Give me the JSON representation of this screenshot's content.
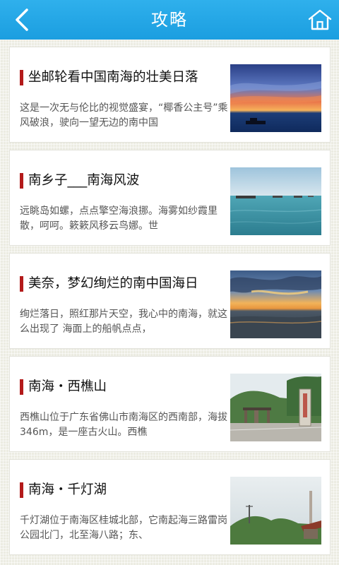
{
  "header": {
    "title": "攻略",
    "back_icon": "chevron-left-icon",
    "home_icon": "home-icon"
  },
  "colors": {
    "header": "#1ea2e3",
    "accent_bar": "#b31a1a"
  },
  "articles": [
    {
      "title": "坐邮轮看中国南海的壮美日落",
      "desc": "这是一次无与伦比的视觉盛宴，“椰香公主号”乘风破浪，驶向一望无边的南中国",
      "image": "sunset-cruise-image"
    },
    {
      "title": "南乡子___南海风波",
      "desc": "远眺岛如螺，点点擎空海浪挪。海雾如纱霞里散，呵呵。簌簌风移云鸟娜。世",
      "image": "sea-boats-image"
    },
    {
      "title": "美奈，梦幻绚烂的南中国海日",
      "desc": "绚烂落日，照红那片天空，我心中的南海，就这么出现了 海面上的船帆点点，",
      "image": "beach-sunset-image"
    },
    {
      "title": "南海・西樵山",
      "desc": "西樵山位于广东省佛山市南海区的西南部，海拔346m，是一座古火山。西樵",
      "image": "xiqiao-mountain-image"
    },
    {
      "title": "南海・千灯湖",
      "desc": "千灯湖位于南海区桂城北部，它南起海三路雷岗公园北门，北至海八路；东、",
      "image": "qiandeng-lake-image"
    }
  ]
}
